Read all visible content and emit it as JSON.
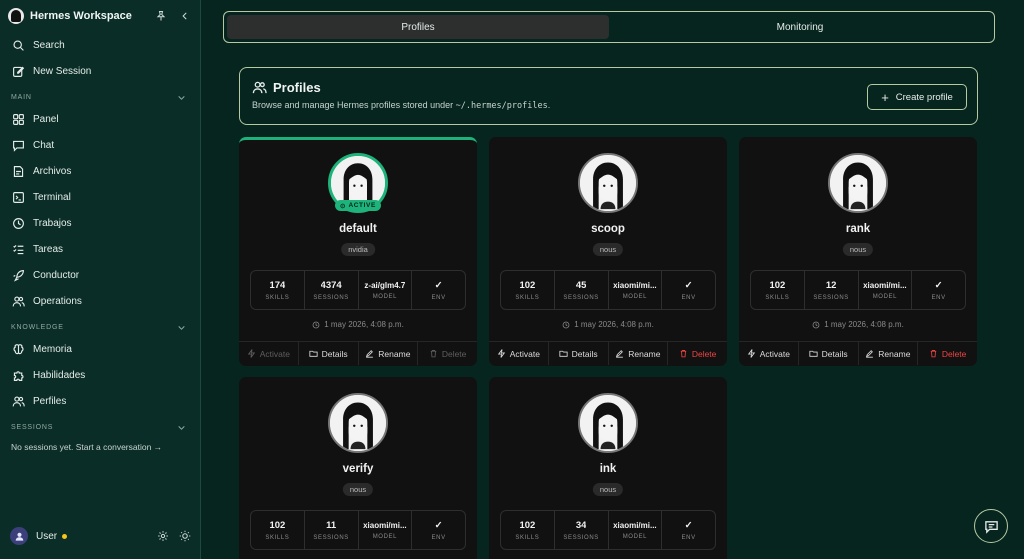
{
  "app": {
    "title": "Hermes Workspace"
  },
  "sidebar": {
    "top_items": [
      {
        "label": "Search",
        "icon": "search-icon"
      },
      {
        "label": "New Session",
        "icon": "edit-icon"
      }
    ],
    "main_label": "MAIN",
    "main_items": [
      {
        "label": "Panel",
        "icon": "grid-icon"
      },
      {
        "label": "Chat",
        "icon": "chat-icon"
      },
      {
        "label": "Archivos",
        "icon": "file-icon"
      },
      {
        "label": "Terminal",
        "icon": "terminal-icon"
      },
      {
        "label": "Trabajos",
        "icon": "clock-icon"
      },
      {
        "label": "Tareas",
        "icon": "list-icon"
      },
      {
        "label": "Conductor",
        "icon": "rocket-icon"
      },
      {
        "label": "Operations",
        "icon": "users-icon"
      }
    ],
    "knowledge_label": "KNOWLEDGE",
    "knowledge_items": [
      {
        "label": "Memoria",
        "icon": "brain-icon"
      },
      {
        "label": "Habilidades",
        "icon": "puzzle-icon"
      },
      {
        "label": "Perfiles",
        "icon": "users-icon"
      }
    ],
    "sessions_label": "SESSIONS",
    "sessions_empty": "No sessions yet. Start a conversation →",
    "user": {
      "name": "User",
      "status_color": "#f5c518"
    }
  },
  "tabs": [
    {
      "label": "Profiles",
      "active": true
    },
    {
      "label": "Monitoring",
      "active": false
    }
  ],
  "profiles_header": {
    "title": "Profiles",
    "subtitle_prefix": "Browse and manage Hermes profiles stored under ",
    "subtitle_path": "~/.hermes/profiles",
    "subtitle_suffix": ".",
    "create_label": "Create profile"
  },
  "stat_labels": {
    "skills": "SKILLS",
    "sessions": "SESSIONS",
    "model": "MODEL",
    "env": "ENV"
  },
  "action_labels": {
    "activate": "Activate",
    "details": "Details",
    "rename": "Rename",
    "delete": "Delete"
  },
  "active_badge": "ACTIVE",
  "profiles": [
    {
      "name": "default",
      "tag": "nvidia",
      "skills": "174",
      "sessions": "4374",
      "model": "z-ai/glm4.7",
      "env": "✓",
      "date": "1 may 2026, 4:08 p.m.",
      "active": true
    },
    {
      "name": "scoop",
      "tag": "nous",
      "skills": "102",
      "sessions": "45",
      "model": "xiaomi/mi...",
      "env": "✓",
      "date": "1 may 2026, 4:08 p.m.",
      "active": false
    },
    {
      "name": "rank",
      "tag": "nous",
      "skills": "102",
      "sessions": "12",
      "model": "xiaomi/mi...",
      "env": "✓",
      "date": "1 may 2026, 4:08 p.m.",
      "active": false
    },
    {
      "name": "verify",
      "tag": "nous",
      "skills": "102",
      "sessions": "11",
      "model": "xiaomi/mi...",
      "env": "✓",
      "date": "",
      "active": false
    },
    {
      "name": "ink",
      "tag": "nous",
      "skills": "102",
      "sessions": "34",
      "model": "xiaomi/mi...",
      "env": "✓",
      "date": "",
      "active": false
    }
  ],
  "colors": {
    "accent": "#1db37a",
    "danger": "#ef4444",
    "background": "#06251f",
    "card": "#111111"
  }
}
